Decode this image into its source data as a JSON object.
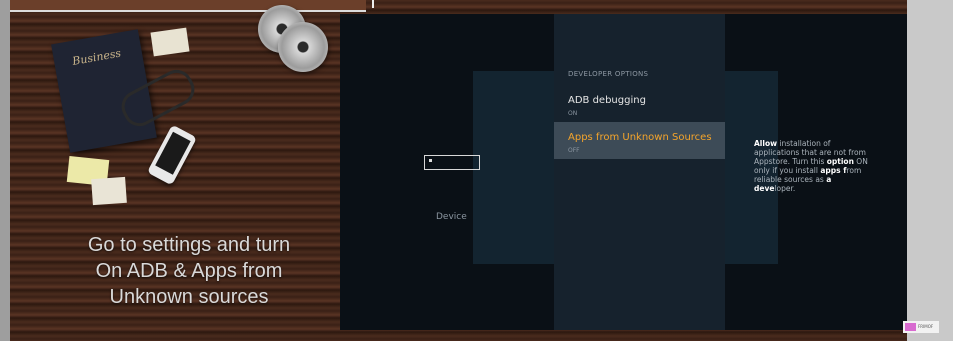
{
  "caption": {
    "line1": "Go to settings and turn",
    "line2": "On ADB & Apps from",
    "line3": "Unknown sources"
  },
  "desk": {
    "book_title": "Business"
  },
  "tv": {
    "nav_label": "Device",
    "section_title": "DEVELOPER OPTIONS",
    "options": [
      {
        "label": "ADB debugging",
        "state": "ON"
      },
      {
        "label": "Apps from Unknown Sources",
        "state": "OFF"
      }
    ],
    "description": {
      "w1": "Allow",
      "t1": " installation of applications that are not from Appstore. Turn this ",
      "w2": "option",
      "t2": " ON only if you install ",
      "w3": "apps f",
      "t3": "rom reliable sources as ",
      "w4": "a deve",
      "t4": "loper."
    },
    "accent_color": "#f4a42b"
  },
  "watermark": {
    "text": "FRIMOF"
  }
}
